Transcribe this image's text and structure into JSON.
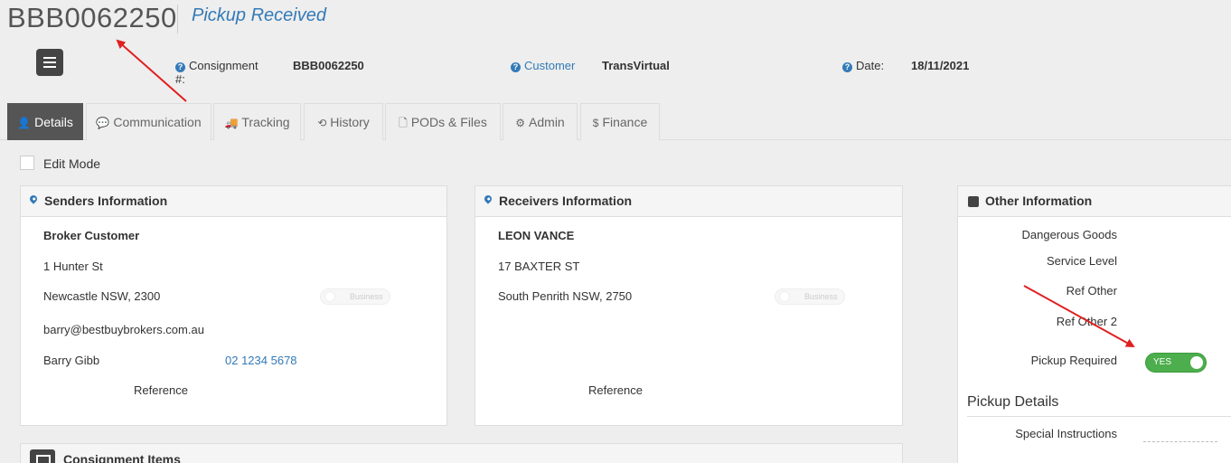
{
  "header": {
    "consignment_id": "BBB0062250",
    "status": "Pickup Received",
    "consignment_label": "Consignment",
    "consignment_label_suffix": "#:",
    "consignment_value": "BBB0062250",
    "customer_label": "Customer",
    "customer_value": "TransVirtual",
    "date_label": "Date:",
    "date_value": "18/11/2021"
  },
  "tabs": [
    {
      "label": "Details",
      "icon": "user-icon",
      "glyph": "👤"
    },
    {
      "label": "Communication",
      "icon": "comment-icon",
      "glyph": "💬"
    },
    {
      "label": "Tracking",
      "icon": "truck-icon",
      "glyph": "🚚"
    },
    {
      "label": "History",
      "icon": "history-icon",
      "glyph": "⟲"
    },
    {
      "label": "PODs & Files",
      "icon": "file-icon",
      "glyph": "🗋"
    },
    {
      "label": "Admin",
      "icon": "gear-icon",
      "glyph": "⚙"
    },
    {
      "label": "Finance",
      "icon": "dollar-icon",
      "glyph": "$"
    }
  ],
  "edit_mode_label": "Edit Mode",
  "senders": {
    "title": "Senders Information",
    "name": "Broker Customer",
    "address1": "1 Hunter St",
    "address2": "Newcastle NSW, 2300",
    "toggle_label": "Business",
    "email": "barry@bestbuybrokers.com.au",
    "contact": "Barry Gibb",
    "phone": "02 1234 5678",
    "reference_label": "Reference"
  },
  "receivers": {
    "title": "Receivers Information",
    "name": "LEON VANCE",
    "address1": "17 BAXTER ST",
    "address2": "South Penrith NSW, 2750",
    "toggle_label": "Business",
    "reference_label": "Reference"
  },
  "other": {
    "title": "Other Information",
    "dangerous_goods": "Dangerous Goods",
    "service_level": "Service Level",
    "ref_other": "Ref Other",
    "ref_other_2": "Ref Other 2",
    "pickup_required": "Pickup Required",
    "pickup_toggle": "YES",
    "pickup_details": "Pickup Details",
    "special_instructions": "Special Instructions"
  },
  "items": {
    "title": "Consignment Items"
  },
  "colors": {
    "accent": "#337ab7",
    "active_tab": "#555555",
    "toggle_on": "#4cae4c",
    "annotation_arrow": "#e02020"
  }
}
